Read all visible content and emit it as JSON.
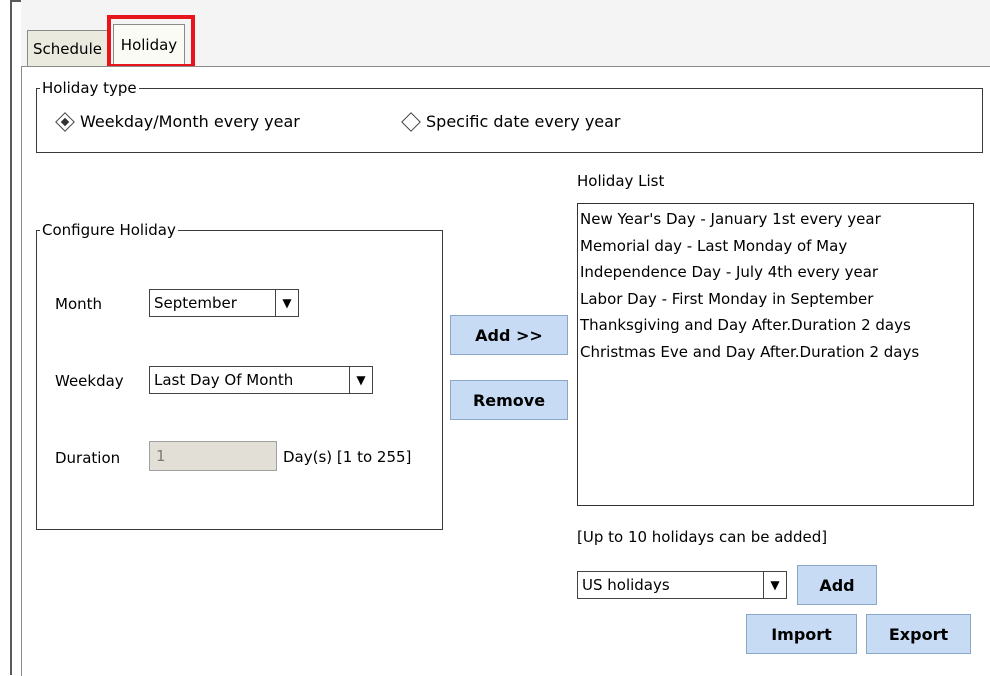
{
  "tabs": [
    {
      "label": "Schedule"
    },
    {
      "label": "Holiday"
    }
  ],
  "holiday_type": {
    "legend": "Holiday type",
    "options": [
      {
        "label": "Weekday/Month every year",
        "selected": true
      },
      {
        "label": "Specific date every year",
        "selected": false
      }
    ]
  },
  "configure": {
    "legend": "Configure Holiday",
    "month_label": "Month",
    "month_value": "September",
    "weekday_label": "Weekday",
    "weekday_value": "Last Day Of Month",
    "duration_label": "Duration",
    "duration_value": "1",
    "duration_suffix": "Day(s) [1 to 255]"
  },
  "buttons": {
    "add": "Add >>",
    "remove": "Remove",
    "add_template": "Add",
    "import": "Import",
    "export": "Export"
  },
  "holiday_list": {
    "title": "Holiday List",
    "items": [
      "New Year's Day - January 1st every year",
      "Memorial day - Last Monday of May",
      "Independence Day - July 4th every year",
      "Labor Day - First Monday in September",
      "Thanksgiving and Day After.Duration 2 days",
      "Christmas Eve and Day After.Duration 2 days"
    ],
    "limit_note": "[Up to 10 holidays can be added]"
  },
  "template": {
    "value": "US holidays"
  },
  "colors": {
    "button_bg": "#c7dcf4",
    "highlight": "#e8141b"
  }
}
